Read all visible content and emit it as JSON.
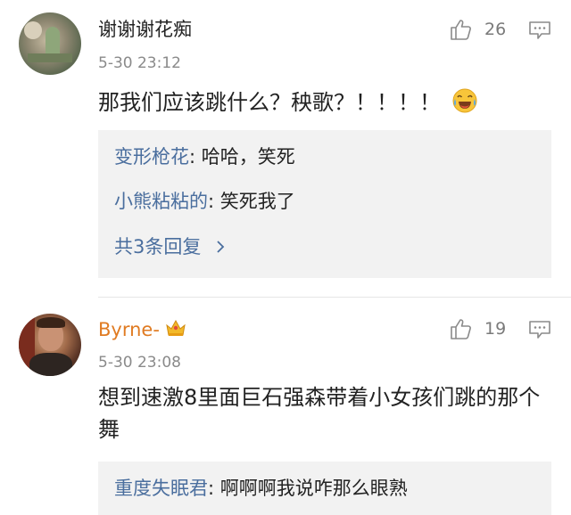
{
  "comments": [
    {
      "username": "谢谢谢花痴",
      "time": "5-30 23:12",
      "likes": "26",
      "body_text": "那我们应该跳什么？秧歌？！！！！",
      "emoji": "laughing-crying-face",
      "replies": [
        {
          "name": "变形枪花",
          "sep": ": ",
          "text": "哈哈，笑死"
        },
        {
          "name": "小熊粘粘的",
          "sep": ": ",
          "text": "笑死我了"
        }
      ],
      "more_replies": "共3条回复"
    },
    {
      "username": "Byrne-",
      "badge_icon": "crown-icon",
      "time": "5-30 23:08",
      "likes": "19",
      "body_text": "想到速激8里面巨石强森带着小女孩们跳的那个舞",
      "replies": [
        {
          "name": "重度失眠君",
          "sep": ": ",
          "text": "啊啊啊我说咋那么眼熟"
        }
      ]
    }
  ],
  "colors": {
    "link_blue": "#4a6e9e",
    "vip_orange": "#e07b22",
    "meta_gray": "#8a8a8a",
    "reply_bg": "#f2f2f2"
  }
}
